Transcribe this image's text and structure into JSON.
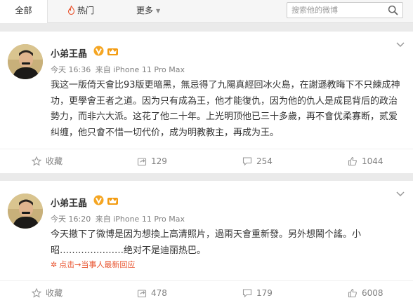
{
  "tabs": {
    "all": "全部",
    "hot": "热门",
    "more": "更多"
  },
  "search": {
    "placeholder": "搜索他的微博"
  },
  "posts": [
    {
      "author": "小弟王晶",
      "time": "今天 16:36",
      "source": "来自 iPhone 11 Pro Max",
      "text": "我这一版倚天會比93版更暗黑，無忌得了九陽真經回冰火島，在謝遜教晦下不只練成神功，更學會王者之道。因为只有成為王，他才能復仇，因为他的仇人是成昆背后的政治勢力，而非六大派。这花了他二十年。上光明顶他已三十多歲，再不會优柔寡断，贰爱纠缠，他只會不惜一切代价，成为明教教主，再成为王。",
      "fav_label": "收藏",
      "forwards": "129",
      "comments": "254",
      "likes": "1044"
    },
    {
      "author": "小弟王晶",
      "time": "今天 16:20",
      "source": "来自 iPhone 11 Pro Max",
      "text": "今天撤下了微博是因为想換上高清照片，過兩天會重新發。另外想鬧个謠。小昭…………………绝对不是迪丽热巴。",
      "reply_link": "点击→当事人最新回应",
      "fav_label": "收藏",
      "forwards": "478",
      "comments": "179",
      "likes": "6008"
    }
  ]
}
